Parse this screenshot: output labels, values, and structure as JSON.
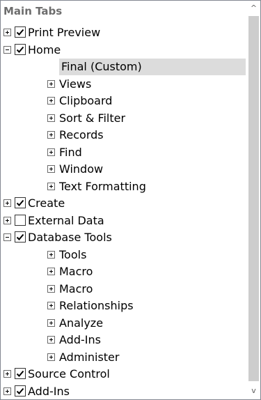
{
  "tree": {
    "header": "Main Tabs",
    "items": [
      {
        "label": "Print Preview",
        "level": 0,
        "expander": "plus",
        "checked": true
      },
      {
        "label": "Home",
        "level": 0,
        "expander": "minus",
        "checked": true
      },
      {
        "label": "Final (Custom)",
        "level": 1,
        "expander": "none",
        "selected": true
      },
      {
        "label": "Views",
        "level": 1,
        "expander": "plus"
      },
      {
        "label": "Clipboard",
        "level": 1,
        "expander": "plus"
      },
      {
        "label": "Sort & Filter",
        "level": 1,
        "expander": "plus"
      },
      {
        "label": "Records",
        "level": 1,
        "expander": "plus"
      },
      {
        "label": "Find",
        "level": 1,
        "expander": "plus"
      },
      {
        "label": "Window",
        "level": 1,
        "expander": "plus"
      },
      {
        "label": "Text Formatting",
        "level": 1,
        "expander": "plus"
      },
      {
        "label": "Create",
        "level": 0,
        "expander": "plus",
        "checked": true
      },
      {
        "label": "External Data",
        "level": 0,
        "expander": "plus",
        "checked": false
      },
      {
        "label": "Database Tools",
        "level": 0,
        "expander": "minus",
        "checked": true
      },
      {
        "label": "Tools",
        "level": 1,
        "expander": "plus"
      },
      {
        "label": "Macro",
        "level": 1,
        "expander": "plus"
      },
      {
        "label": "Macro",
        "level": 1,
        "expander": "plus"
      },
      {
        "label": "Relationships",
        "level": 1,
        "expander": "plus"
      },
      {
        "label": "Analyze",
        "level": 1,
        "expander": "plus"
      },
      {
        "label": "Add-Ins",
        "level": 1,
        "expander": "plus"
      },
      {
        "label": "Administer",
        "level": 1,
        "expander": "plus"
      },
      {
        "label": "Source Control",
        "level": 0,
        "expander": "plus",
        "checked": true
      },
      {
        "label": "Add-Ins",
        "level": 0,
        "expander": "plus",
        "checked": true
      }
    ]
  },
  "scrollbar": {
    "up_glyph": "^",
    "down_glyph": "v"
  },
  "colors": {
    "selection": "#dcdcdc",
    "scroll_thumb": "#cdcdcd",
    "header_text": "#6d6d6d"
  }
}
